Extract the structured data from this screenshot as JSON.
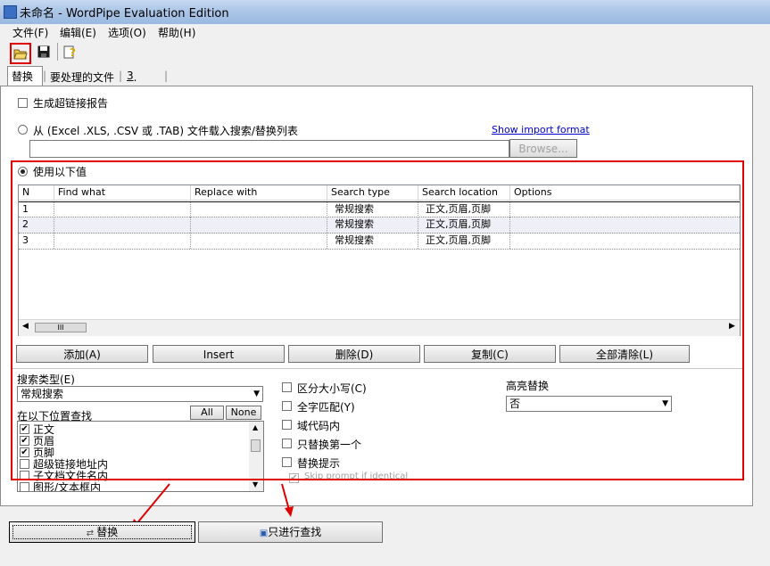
{
  "window": {
    "title": "未命名 - WordPipe Evaluation Edition"
  },
  "menu": {
    "file": "文件(F)",
    "edit": "编辑(E)",
    "options": "选项(O)",
    "help": "帮助(H)"
  },
  "tabs": {
    "replace": "替换",
    "files": "要处理的文件",
    "options_prefix": "3",
    "options": ". 选项"
  },
  "report": {
    "label": "生成超链接报告"
  },
  "load": {
    "label": "从 (Excel .XLS, .CSV 或 .TAB) 文件载入搜索/替换列表",
    "link": "Show import format",
    "browse": "Browse..."
  },
  "use_values": {
    "label": "使用以下值"
  },
  "grid": {
    "columns": [
      "N",
      "Find what",
      "Replace with",
      "Search type",
      "Search location",
      "Options"
    ],
    "rows": [
      {
        "n": "1",
        "find": "",
        "replace": "",
        "type": "常规搜索",
        "location": "正文,页眉,页脚",
        "options": ""
      },
      {
        "n": "2",
        "find": "",
        "replace": "",
        "type": "常规搜索",
        "location": "正文,页眉,页脚",
        "options": ""
      },
      {
        "n": "3",
        "find": "",
        "replace": "",
        "type": "常规搜索",
        "location": "正文,页眉,页脚",
        "options": ""
      }
    ],
    "scroll_glyph": "III"
  },
  "actions": {
    "add": "添加(A)",
    "insert": "Insert",
    "delete": "删除(D)",
    "copy": "复制(C)",
    "clear": "全部清除(L)"
  },
  "search_type": {
    "label": "搜索类型(E)",
    "value": "常规搜索"
  },
  "search_in": {
    "label": "在以下位置查找",
    "all": "All",
    "none": "None",
    "items": [
      {
        "label": "正文",
        "checked": true
      },
      {
        "label": "页眉",
        "checked": true
      },
      {
        "label": "页脚",
        "checked": true
      },
      {
        "label": "超级链接地址内",
        "checked": false
      },
      {
        "label": "子文档文件名内",
        "checked": false
      },
      {
        "label": "图形/文本框内",
        "checked": false
      }
    ]
  },
  "options": {
    "case": "区分大小写(C)",
    "whole_word": "全字匹配(Y)",
    "field_codes": "域代码内",
    "first_only": "只替换第一个",
    "prompt": "替换提示",
    "skip_prompt": "Skip prompt if identical"
  },
  "highlight": {
    "label": "高亮替换",
    "value": "否"
  },
  "bottom": {
    "replace": "替换",
    "find_only": "只进行查找"
  },
  "colors": {
    "annotation": "#e00000"
  }
}
